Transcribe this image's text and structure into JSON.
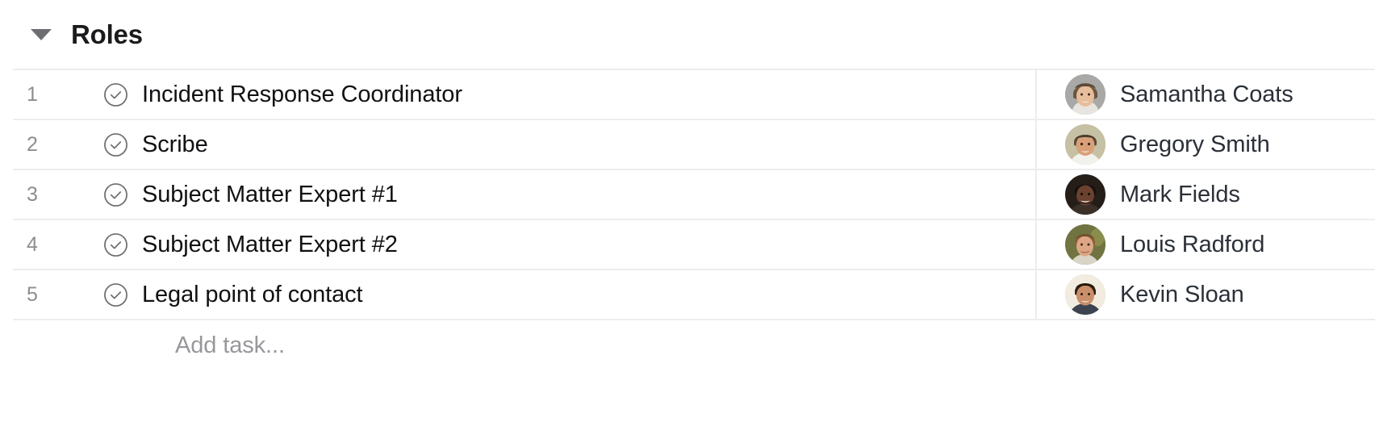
{
  "section": {
    "title": "Roles",
    "caret_icon": "chevron-down-icon",
    "expanded": true
  },
  "table": {
    "check_icon": "check-circle-icon",
    "rows": [
      {
        "number": "1",
        "task": "Incident Response Coordinator",
        "assignee": "Samantha Coats",
        "avatar_bg": "#a8a9a6",
        "avatar_skin": "#e8bd9b",
        "avatar_hair": "#6b563f"
      },
      {
        "number": "2",
        "task": "Scribe",
        "assignee": "Gregory Smith",
        "avatar_bg": "#c6c0a4",
        "avatar_skin": "#d9a078",
        "avatar_hair": "#5a4a38"
      },
      {
        "number": "3",
        "task": "Subject Matter Expert #1",
        "assignee": "Mark Fields",
        "avatar_bg": "#241d18",
        "avatar_skin": "#6b4230",
        "avatar_hair": "#140f0c"
      },
      {
        "number": "4",
        "task": "Subject Matter Expert #2",
        "assignee": "Louis Radford",
        "avatar_bg": "#6f7441",
        "avatar_skin": "#dda684",
        "avatar_hair": "#8a5f35"
      },
      {
        "number": "5",
        "task": "Legal point of contact",
        "assignee": "Kevin Sloan",
        "avatar_bg": "#f2ece0",
        "avatar_skin": "#c98f68",
        "avatar_hair": "#2e2016"
      }
    ]
  },
  "add_task": {
    "label": "Add task..."
  },
  "colors": {
    "border": "#ededee",
    "task_text": "#111114",
    "name_text": "#2b3038",
    "muted_text": "#8c8d90",
    "placeholder_text": "#97989b",
    "icon_stroke": "#6d6e71"
  }
}
